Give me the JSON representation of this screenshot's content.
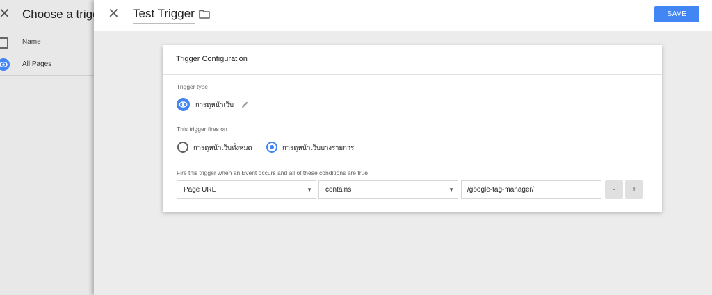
{
  "background_panel": {
    "title": "Choose a trigg",
    "column_header": "Name",
    "rows": [
      {
        "label": "All Pages",
        "icon": "eye-icon"
      }
    ]
  },
  "editor": {
    "title": "Test Trigger",
    "save_label": "SAVE",
    "accent_color": "#4285f4"
  },
  "card": {
    "title": "Trigger Configuration",
    "trigger_type_label": "Trigger type",
    "trigger_type_value": "การดูหน้าเว็บ",
    "fires_on_label": "This trigger fires on",
    "fires_on_options": [
      {
        "label": "การดูหน้าเว็บทั้งหมด",
        "selected": false
      },
      {
        "label": "การดูหน้าเว็บบางรายการ",
        "selected": true
      }
    ],
    "condition_label": "Fire this trigger when an Event occurs and all of these conditions are true",
    "condition": {
      "variable": "Page URL",
      "operator": "contains",
      "value": "/google-tag-manager/"
    },
    "remove_label": "-",
    "add_label": "+"
  }
}
